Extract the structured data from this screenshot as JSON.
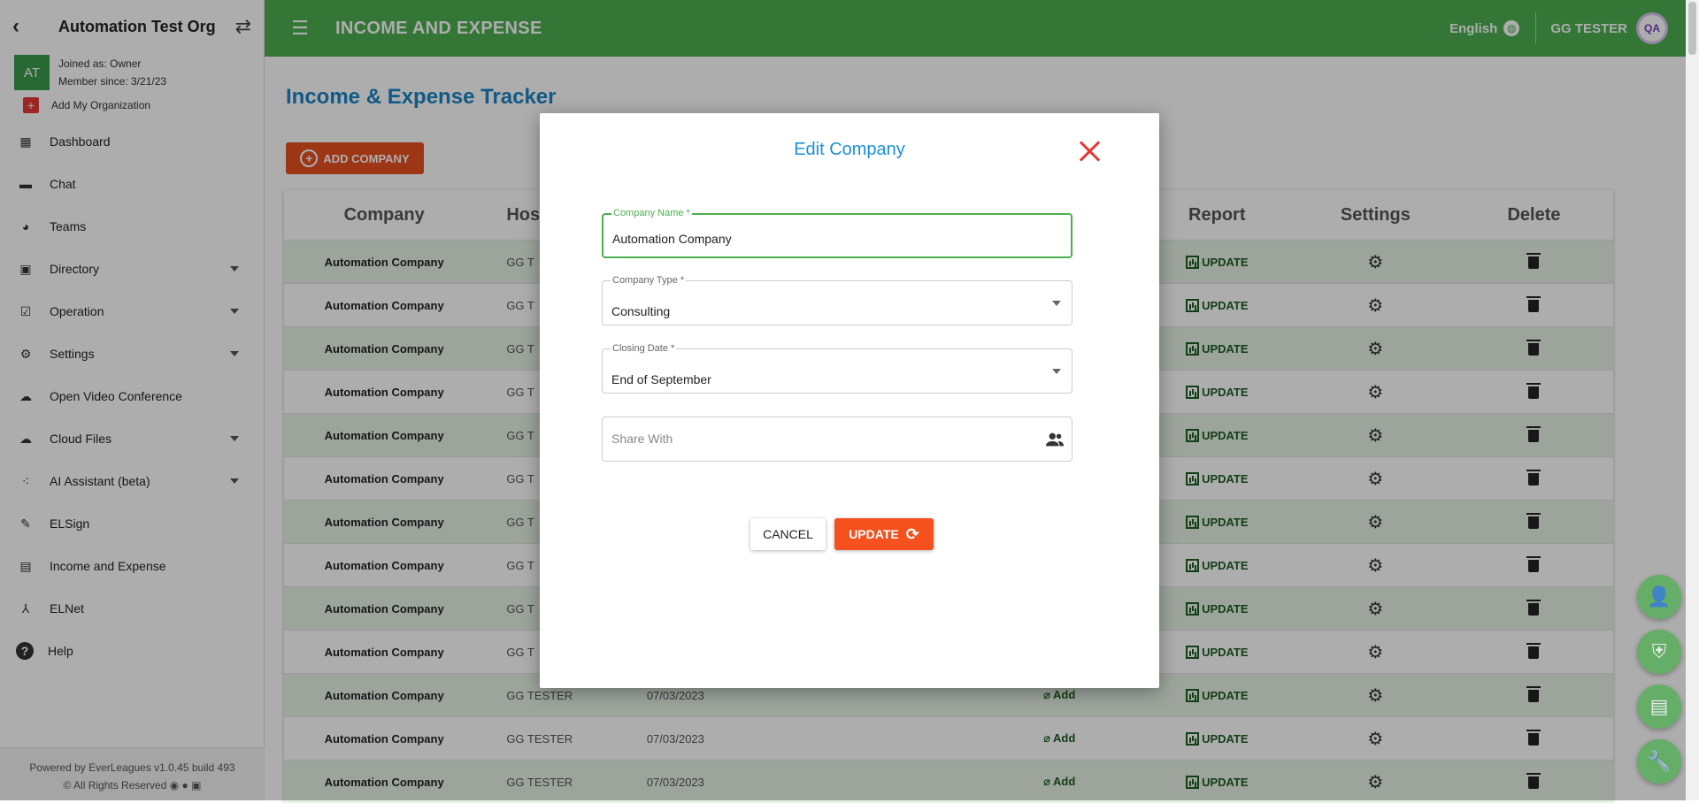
{
  "sidebar": {
    "org_name": "Automation Test Org",
    "avatar_initials": "AT",
    "joined_as": "Joined as: Owner",
    "member_since": "Member since: 3/21/23",
    "add_org": "Add My Organization",
    "items": [
      {
        "label": "Dashboard",
        "icon": "dashboard-icon",
        "caret": false
      },
      {
        "label": "Chat",
        "icon": "chat-icon",
        "caret": false
      },
      {
        "label": "Teams",
        "icon": "teams-icon",
        "caret": false
      },
      {
        "label": "Directory",
        "icon": "directory-icon",
        "caret": true
      },
      {
        "label": "Operation",
        "icon": "operation-icon",
        "caret": true
      },
      {
        "label": "Settings",
        "icon": "settings-icon",
        "caret": true
      },
      {
        "label": "Open Video Conference",
        "icon": "video-icon",
        "caret": false
      },
      {
        "label": "Cloud Files",
        "icon": "cloud-icon",
        "caret": true
      },
      {
        "label": "AI Assistant (beta)",
        "icon": "ai-icon",
        "caret": true
      },
      {
        "label": "ELSign",
        "icon": "pen-icon",
        "caret": false
      },
      {
        "label": "Income and Expense",
        "icon": "income-icon",
        "caret": false
      },
      {
        "label": "ELNet",
        "icon": "network-icon",
        "caret": false
      },
      {
        "label": "Help",
        "icon": "help-icon",
        "caret": false
      }
    ],
    "footer_line1": "Powered by EverLeagues v1.0.45 build 493",
    "footer_line2": "© All Rights Reserved"
  },
  "topbar": {
    "title": "INCOME AND EXPENSE",
    "language": "English",
    "user": "GG TESTER",
    "user_avatar_text": "QA"
  },
  "main": {
    "title": "Income & Expense Tracker",
    "add_button": "ADD COMPANY",
    "columns": {
      "company": "Company",
      "host": "Host",
      "report": "Report",
      "settings": "Settings",
      "delete": "Delete"
    },
    "row_company": "Automation Company",
    "row_host": "GG TESTER",
    "row_host_partial": "GG T",
    "row_date": "07/03/2023",
    "row_add": "Add",
    "row_update": "UPDATE",
    "row_count": 13
  },
  "modal": {
    "title": "Edit Company",
    "company_name_label": "Company Name *",
    "company_name_value": "Automation Company",
    "company_type_label": "Company Type *",
    "company_type_value": "Consulting",
    "closing_date_label": "Closing Date *",
    "closing_date_value": "End of September",
    "share_with_placeholder": "Share With",
    "cancel_label": "CANCEL",
    "update_label": "UPDATE"
  },
  "colors": {
    "topbar": "#4caf50",
    "accent_blue": "#1a83c6",
    "add_button": "#e8501f",
    "update_button": "#f4511e",
    "close_x": "#e53935",
    "row_alt": "#e6f2e6"
  }
}
